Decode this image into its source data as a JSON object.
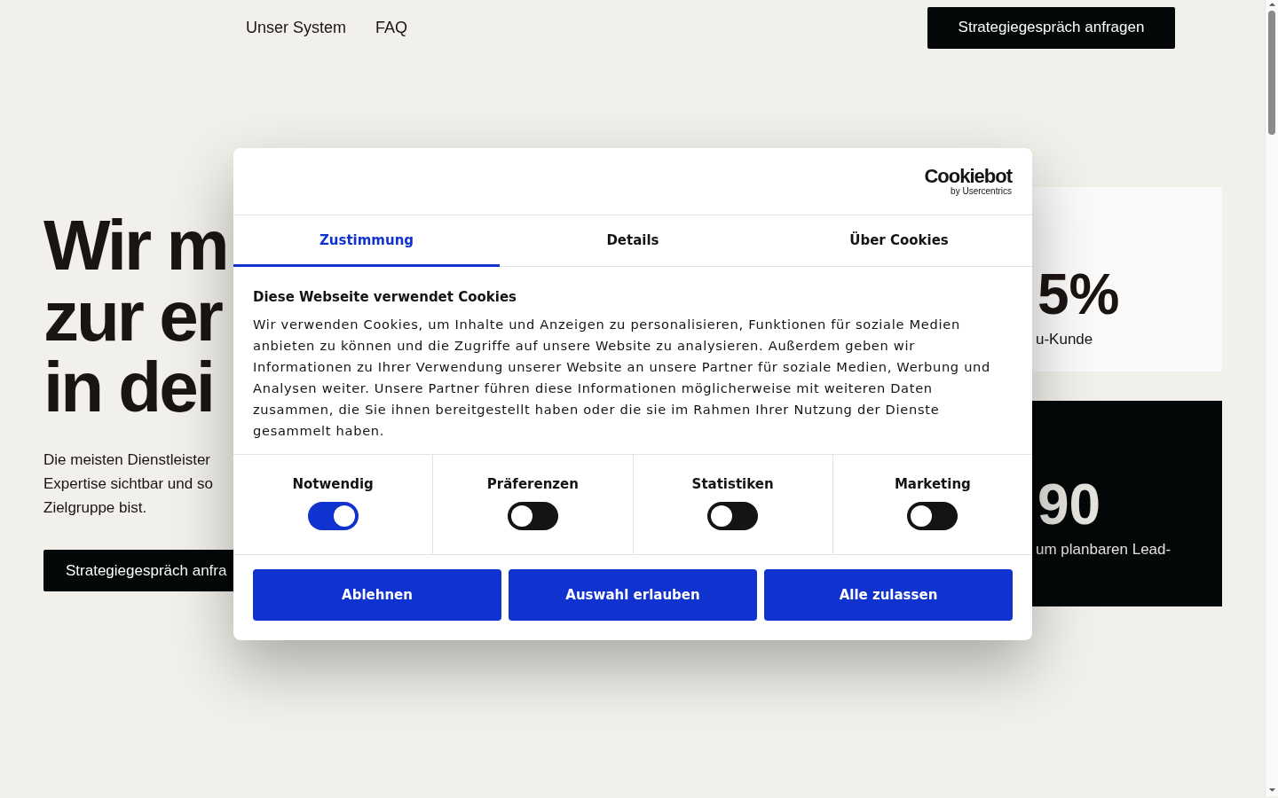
{
  "nav": {
    "links": [
      "Unser System",
      "FAQ"
    ],
    "cta": "Strategiegespräch anfragen"
  },
  "hero": {
    "headline": [
      "Wir m",
      "zur er",
      "in dei"
    ],
    "text": [
      "Die meisten Dienstleister",
      "Expertise sichtbar und so",
      "Zielgruppe bist."
    ],
    "button": "Strategiegespräch anfra"
  },
  "stats": [
    {
      "kind": "light",
      "value": "5%",
      "label": "u-Kunde"
    },
    {
      "kind": "dark",
      "value": "90",
      "label": "um planbaren Lead-"
    }
  ],
  "cookie_dialog": {
    "logo": {
      "name": "Cookiebot",
      "tagline": "by Usercentrics"
    },
    "tabs": [
      {
        "label": "Zustimmung",
        "selected": true
      },
      {
        "label": "Details",
        "selected": false
      },
      {
        "label": "Über Cookies",
        "selected": false
      }
    ],
    "title": "Diese Webseite verwendet Cookies",
    "body": "Wir verwenden Cookies, um Inhalte und Anzeigen zu personalisieren, Funktionen für soziale Medien anbieten zu können und die Zugriffe auf unsere Website zu analysieren. Außerdem geben wir Informationen zu Ihrer Verwendung unserer Website an unsere Partner für soziale Medien, Werbung und Analysen weiter. Unsere Partner führen diese Informationen möglicherweise mit weiteren Daten zusammen, die Sie ihnen bereitgestellt haben oder die sie im Rahmen Ihrer Nutzung der Dienste gesammelt haben.",
    "categories": [
      {
        "label": "Notwendig",
        "on": true
      },
      {
        "label": "Präferenzen",
        "on": false
      },
      {
        "label": "Statistiken",
        "on": false
      },
      {
        "label": "Marketing",
        "on": false
      }
    ],
    "buttons": [
      "Ablehnen",
      "Auswahl erlauben",
      "Alle zulassen"
    ]
  }
}
